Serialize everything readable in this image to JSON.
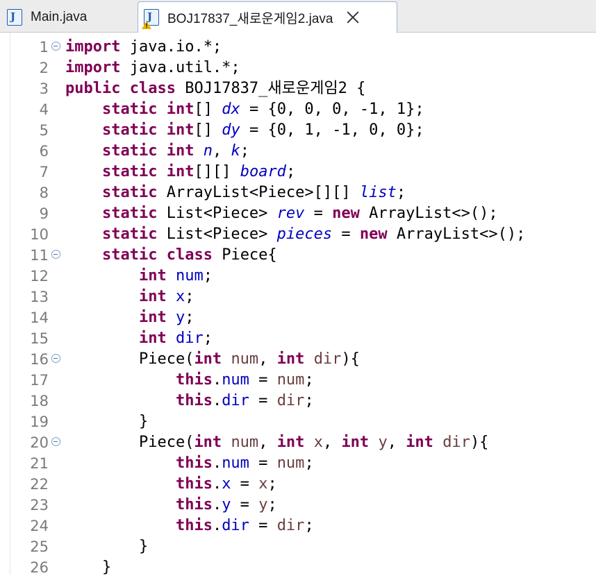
{
  "tabs": [
    {
      "label": "Main.java",
      "icon": "java-file-icon",
      "active": false
    },
    {
      "label": "BOJ17837_새로운게임2.java",
      "icon": "java-file-warning-icon",
      "active": true
    }
  ],
  "colors": {
    "keyword": "#7f0055",
    "static_field": "#0000c0",
    "field": "#0000c0",
    "parameter": "#6a3e3e",
    "line_number": "#7a7a7a"
  },
  "editor": {
    "lines": [
      {
        "n": "1",
        "fold": true,
        "tokens": [
          [
            "kw",
            "import"
          ],
          [
            "t",
            " java.io.*;"
          ]
        ]
      },
      {
        "n": "2",
        "fold": false,
        "tokens": [
          [
            "kw",
            "import"
          ],
          [
            "t",
            " java.util.*;"
          ]
        ]
      },
      {
        "n": "3",
        "fold": false,
        "tokens": [
          [
            "kw",
            "public"
          ],
          [
            "t",
            " "
          ],
          [
            "kw",
            "class"
          ],
          [
            "t",
            " BOJ17837_새로운게임2 {"
          ]
        ]
      },
      {
        "n": "4",
        "fold": false,
        "tokens": [
          [
            "t",
            "    "
          ],
          [
            "kw",
            "static"
          ],
          [
            "t",
            " "
          ],
          [
            "kw",
            "int"
          ],
          [
            "t",
            "[] "
          ],
          [
            "sf",
            "dx"
          ],
          [
            "t",
            " = {0, 0, 0, -1, 1};"
          ]
        ]
      },
      {
        "n": "5",
        "fold": false,
        "tokens": [
          [
            "t",
            "    "
          ],
          [
            "kw",
            "static"
          ],
          [
            "t",
            " "
          ],
          [
            "kw",
            "int"
          ],
          [
            "t",
            "[] "
          ],
          [
            "sf",
            "dy"
          ],
          [
            "t",
            " = {0, 1, -1, 0, 0};"
          ]
        ]
      },
      {
        "n": "6",
        "fold": false,
        "tokens": [
          [
            "t",
            "    "
          ],
          [
            "kw",
            "static"
          ],
          [
            "t",
            " "
          ],
          [
            "kw",
            "int"
          ],
          [
            "t",
            " "
          ],
          [
            "sf",
            "n"
          ],
          [
            "t",
            ", "
          ],
          [
            "sf",
            "k"
          ],
          [
            "t",
            ";"
          ]
        ]
      },
      {
        "n": "7",
        "fold": false,
        "tokens": [
          [
            "t",
            "    "
          ],
          [
            "kw",
            "static"
          ],
          [
            "t",
            " "
          ],
          [
            "kw",
            "int"
          ],
          [
            "t",
            "[][] "
          ],
          [
            "sf",
            "board"
          ],
          [
            "t",
            ";"
          ]
        ]
      },
      {
        "n": "8",
        "fold": false,
        "tokens": [
          [
            "t",
            "    "
          ],
          [
            "kw",
            "static"
          ],
          [
            "t",
            " ArrayList<Piece>[][] "
          ],
          [
            "sf",
            "list"
          ],
          [
            "t",
            ";"
          ]
        ]
      },
      {
        "n": "9",
        "fold": false,
        "tokens": [
          [
            "t",
            "    "
          ],
          [
            "kw",
            "static"
          ],
          [
            "t",
            " List<Piece> "
          ],
          [
            "sf",
            "rev"
          ],
          [
            "t",
            " = "
          ],
          [
            "kw",
            "new"
          ],
          [
            "t",
            " ArrayList<>();"
          ]
        ]
      },
      {
        "n": "10",
        "fold": false,
        "tokens": [
          [
            "t",
            "    "
          ],
          [
            "kw",
            "static"
          ],
          [
            "t",
            " List<Piece> "
          ],
          [
            "sf",
            "pieces"
          ],
          [
            "t",
            " = "
          ],
          [
            "kw",
            "new"
          ],
          [
            "t",
            " ArrayList<>();"
          ]
        ]
      },
      {
        "n": "11",
        "fold": true,
        "tokens": [
          [
            "t",
            "    "
          ],
          [
            "kw",
            "static"
          ],
          [
            "t",
            " "
          ],
          [
            "kw",
            "class"
          ],
          [
            "t",
            " Piece{"
          ]
        ]
      },
      {
        "n": "12",
        "fold": false,
        "tokens": [
          [
            "t",
            "        "
          ],
          [
            "kw",
            "int"
          ],
          [
            "t",
            " "
          ],
          [
            "fd",
            "num"
          ],
          [
            "t",
            ";"
          ]
        ]
      },
      {
        "n": "13",
        "fold": false,
        "tokens": [
          [
            "t",
            "        "
          ],
          [
            "kw",
            "int"
          ],
          [
            "t",
            " "
          ],
          [
            "fd",
            "x"
          ],
          [
            "t",
            ";"
          ]
        ]
      },
      {
        "n": "14",
        "fold": false,
        "tokens": [
          [
            "t",
            "        "
          ],
          [
            "kw",
            "int"
          ],
          [
            "t",
            " "
          ],
          [
            "fd",
            "y"
          ],
          [
            "t",
            ";"
          ]
        ]
      },
      {
        "n": "15",
        "fold": false,
        "tokens": [
          [
            "t",
            "        "
          ],
          [
            "kw",
            "int"
          ],
          [
            "t",
            " "
          ],
          [
            "fd",
            "dir"
          ],
          [
            "t",
            ";"
          ]
        ]
      },
      {
        "n": "16",
        "fold": true,
        "tokens": [
          [
            "t",
            "        Piece("
          ],
          [
            "kw",
            "int"
          ],
          [
            "t",
            " "
          ],
          [
            "pm",
            "num"
          ],
          [
            "t",
            ", "
          ],
          [
            "kw",
            "int"
          ],
          [
            "t",
            " "
          ],
          [
            "pm",
            "dir"
          ],
          [
            "t",
            "){"
          ]
        ]
      },
      {
        "n": "17",
        "fold": false,
        "tokens": [
          [
            "t",
            "            "
          ],
          [
            "kw",
            "this"
          ],
          [
            "t",
            "."
          ],
          [
            "fd",
            "num"
          ],
          [
            "t",
            " = "
          ],
          [
            "pm",
            "num"
          ],
          [
            "t",
            ";"
          ]
        ]
      },
      {
        "n": "18",
        "fold": false,
        "tokens": [
          [
            "t",
            "            "
          ],
          [
            "kw",
            "this"
          ],
          [
            "t",
            "."
          ],
          [
            "fd",
            "dir"
          ],
          [
            "t",
            " = "
          ],
          [
            "pm",
            "dir"
          ],
          [
            "t",
            ";"
          ]
        ]
      },
      {
        "n": "19",
        "fold": false,
        "tokens": [
          [
            "t",
            "        }"
          ]
        ]
      },
      {
        "n": "20",
        "fold": true,
        "tokens": [
          [
            "t",
            "        Piece("
          ],
          [
            "kw",
            "int"
          ],
          [
            "t",
            " "
          ],
          [
            "pm",
            "num"
          ],
          [
            "t",
            ", "
          ],
          [
            "kw",
            "int"
          ],
          [
            "t",
            " "
          ],
          [
            "pm",
            "x"
          ],
          [
            "t",
            ", "
          ],
          [
            "kw",
            "int"
          ],
          [
            "t",
            " "
          ],
          [
            "pm",
            "y"
          ],
          [
            "t",
            ", "
          ],
          [
            "kw",
            "int"
          ],
          [
            "t",
            " "
          ],
          [
            "pm",
            "dir"
          ],
          [
            "t",
            "){"
          ]
        ]
      },
      {
        "n": "21",
        "fold": false,
        "tokens": [
          [
            "t",
            "            "
          ],
          [
            "kw",
            "this"
          ],
          [
            "t",
            "."
          ],
          [
            "fd",
            "num"
          ],
          [
            "t",
            " = "
          ],
          [
            "pm",
            "num"
          ],
          [
            "t",
            ";"
          ]
        ]
      },
      {
        "n": "22",
        "fold": false,
        "tokens": [
          [
            "t",
            "            "
          ],
          [
            "kw",
            "this"
          ],
          [
            "t",
            "."
          ],
          [
            "fd",
            "x"
          ],
          [
            "t",
            " = "
          ],
          [
            "pm",
            "x"
          ],
          [
            "t",
            ";"
          ]
        ]
      },
      {
        "n": "23",
        "fold": false,
        "tokens": [
          [
            "t",
            "            "
          ],
          [
            "kw",
            "this"
          ],
          [
            "t",
            "."
          ],
          [
            "fd",
            "y"
          ],
          [
            "t",
            " = "
          ],
          [
            "pm",
            "y"
          ],
          [
            "t",
            ";"
          ]
        ]
      },
      {
        "n": "24",
        "fold": false,
        "tokens": [
          [
            "t",
            "            "
          ],
          [
            "kw",
            "this"
          ],
          [
            "t",
            "."
          ],
          [
            "fd",
            "dir"
          ],
          [
            "t",
            " = "
          ],
          [
            "pm",
            "dir"
          ],
          [
            "t",
            ";"
          ]
        ]
      },
      {
        "n": "25",
        "fold": false,
        "tokens": [
          [
            "t",
            "        }"
          ]
        ]
      },
      {
        "n": "26",
        "fold": false,
        "tokens": [
          [
            "t",
            "    }"
          ]
        ]
      }
    ]
  }
}
